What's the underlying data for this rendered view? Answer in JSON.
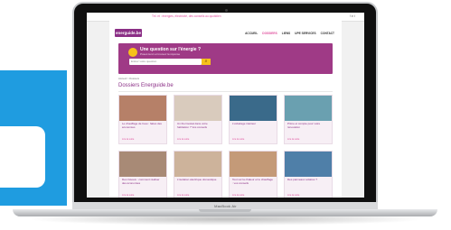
{
  "decor": {
    "accent": "#1f9ce0"
  },
  "laptop": {
    "brand": "MacBook Air"
  },
  "browser": {
    "notice": "Tél. et : énergies, électricité, des conseils au quotidien",
    "social": "f  in  t"
  },
  "site": {
    "logo": "energuide.be",
    "nav": [
      "ACCUEIL",
      "DOSSIERS",
      "LIENS",
      "UPE SERVICES",
      "CONTACT"
    ],
    "nav_active": 1,
    "hero": {
      "title": "Une question sur l'énergie ?",
      "subtitle": "Posez-la ici et trouvez la réponse",
      "search_placeholder": "Entrez votre question",
      "search_icon": "magnifier-icon"
    },
    "breadcrumb": "Accueil > Dossiers",
    "page_title": "Dossiers Energuide.be",
    "cards": [
      {
        "title": "Le chauffage de l'eau : faites des économies",
        "more": "Lire la suite",
        "img": "#b68068"
      },
      {
        "title": "Un thermostat dans votre habitation ? Vos conseils",
        "more": "Lire la suite",
        "img": "#d9cbbd"
      },
      {
        "title": "L'éclairage intérieur",
        "more": "Lire la suite",
        "img": "#3a6a8a"
      },
      {
        "title": "Prime et compte pour votre rénovation",
        "more": "Lire la suite",
        "img": "#6aa0b0"
      },
      {
        "title": "Des travaux : comment réaliser des économies",
        "more": "Lire la suite",
        "img": "#a88a76"
      },
      {
        "title": "L'isolation électrique domestique",
        "more": "Lire la suite",
        "img": "#cdb39b"
      },
      {
        "title": "Tout sur la chaleur et le chauffage : vos conseils",
        "more": "Lire la suite",
        "img": "#c49a78"
      },
      {
        "title": "Des panneaux solaires ?",
        "more": "Lire la suite",
        "img": "#4f7fa8"
      }
    ]
  }
}
